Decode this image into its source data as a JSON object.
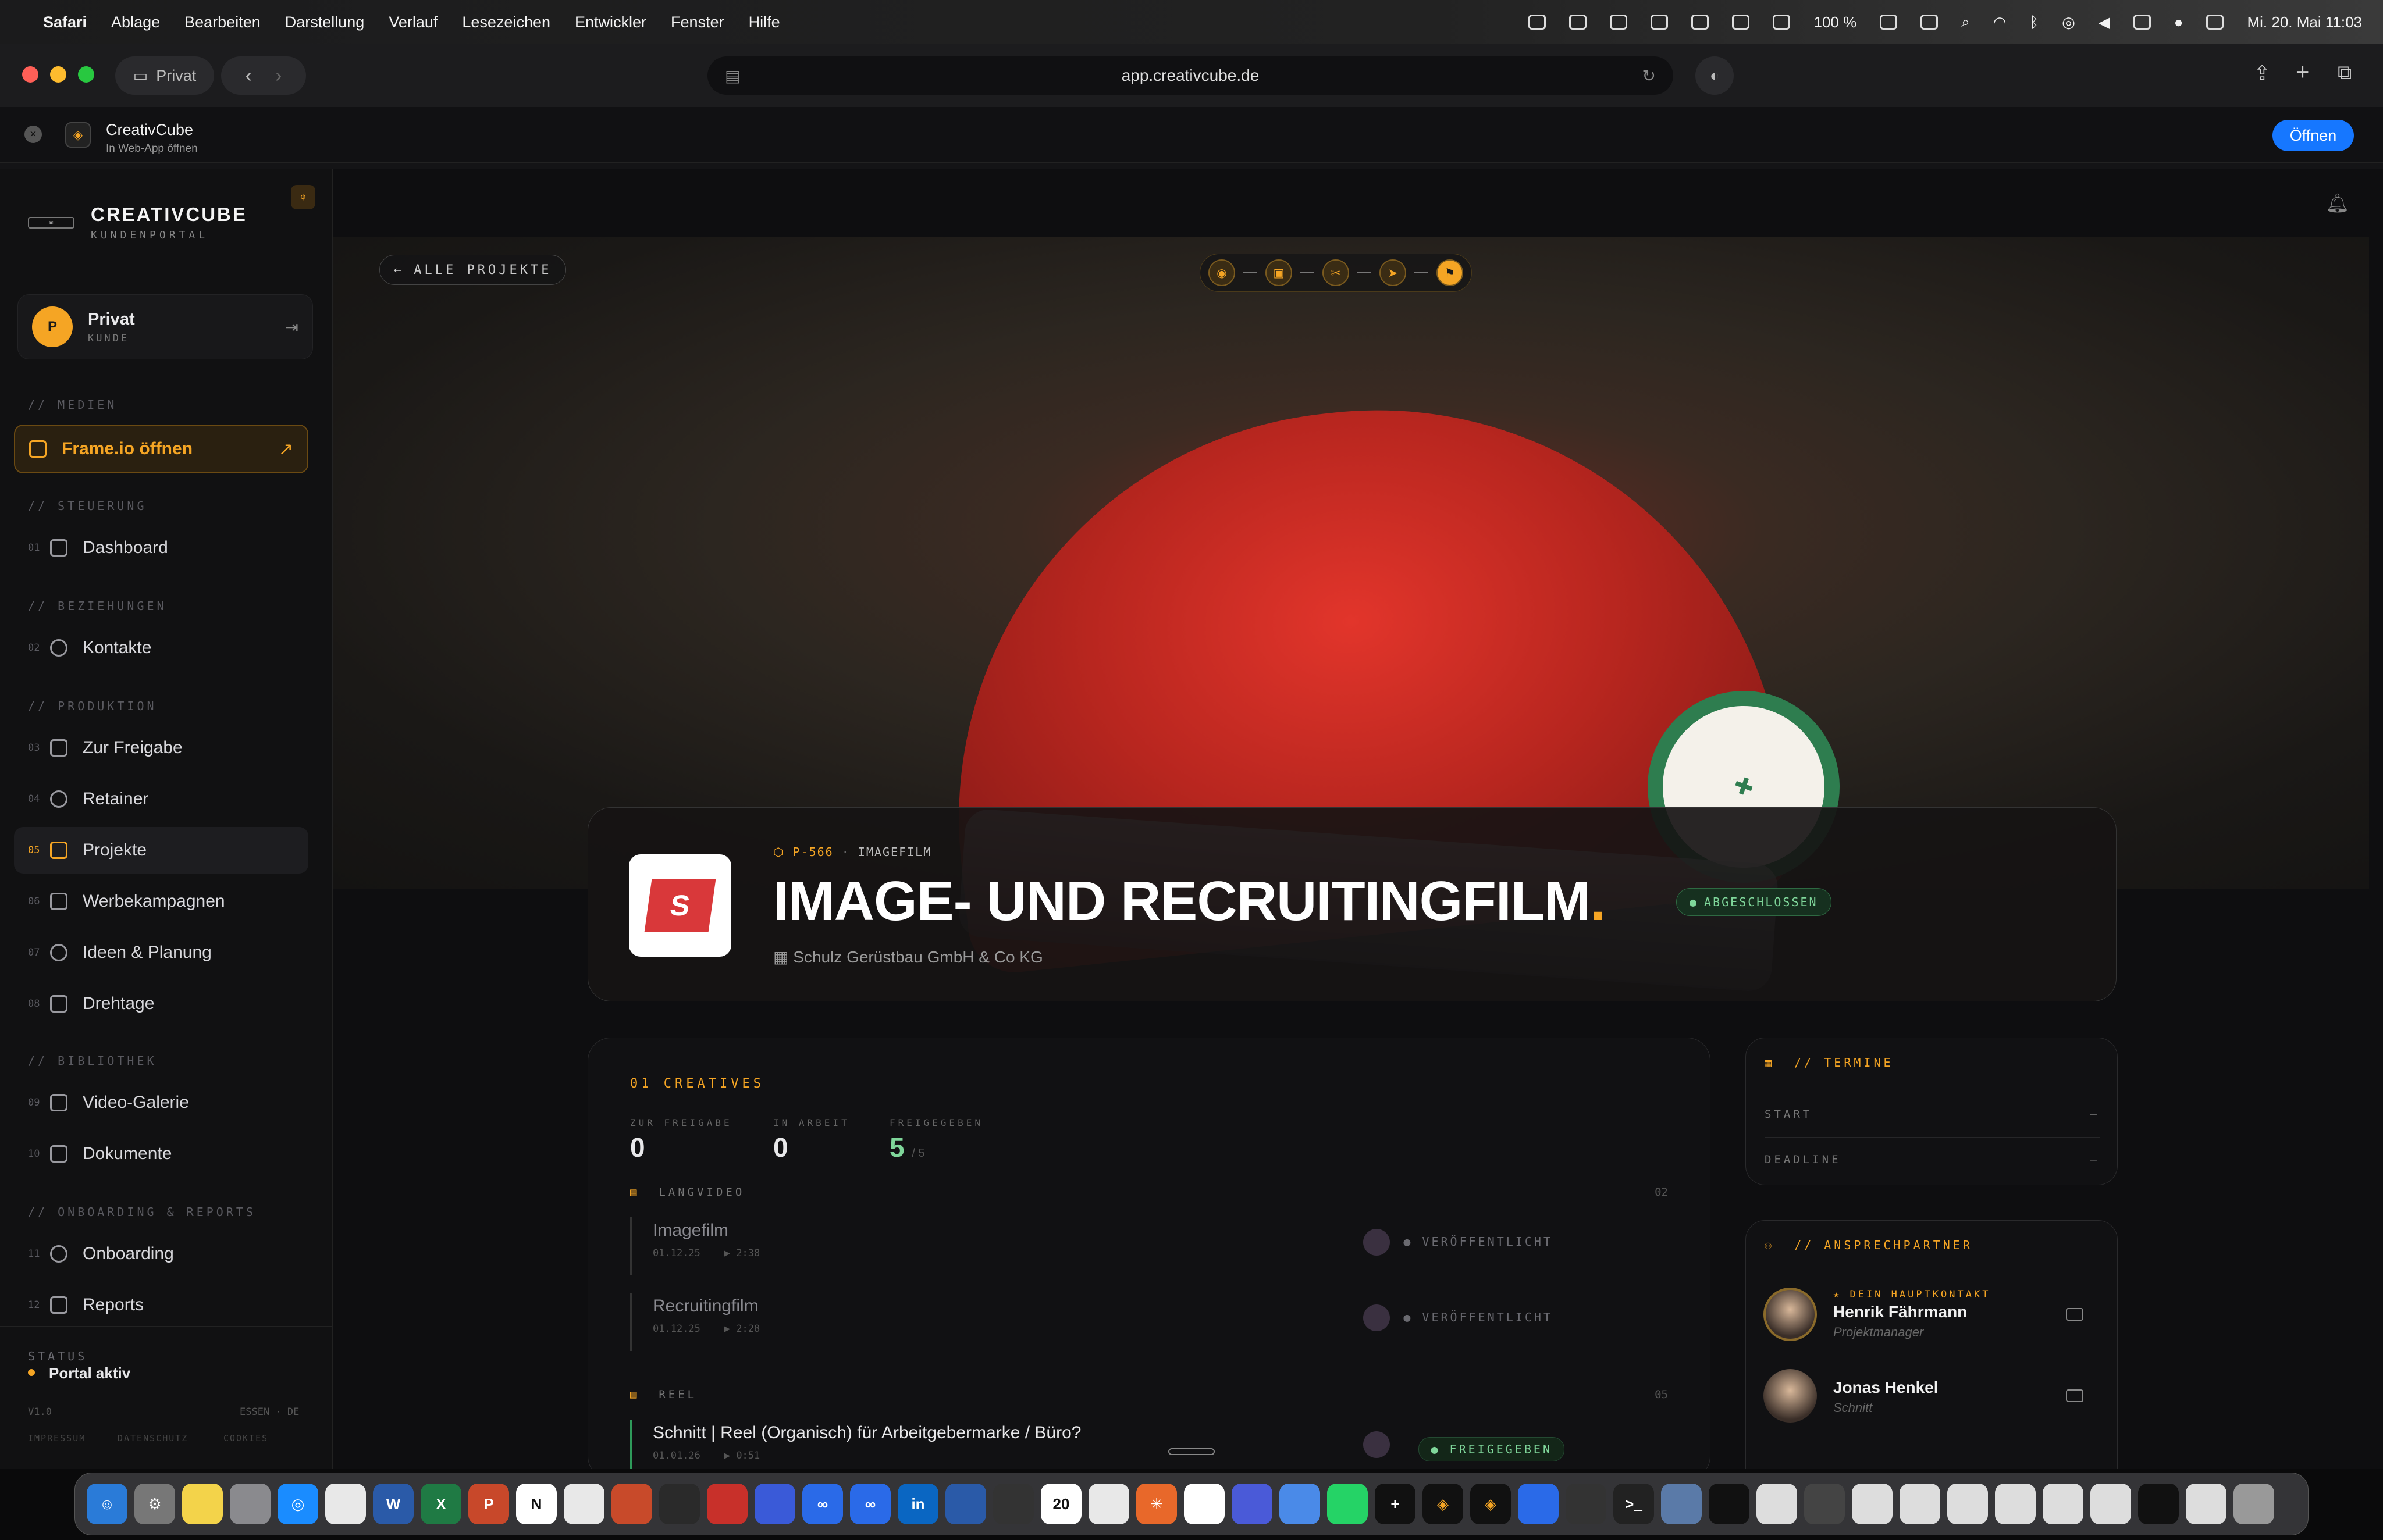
{
  "menubar": {
    "app": "Safari",
    "items": [
      "Ablage",
      "Bearbeiten",
      "Darstellung",
      "Verlauf",
      "Lesezeichen",
      "Entwickler",
      "Fenster",
      "Hilfe"
    ],
    "battery": "100 %",
    "datetime": "Mi. 20. Mai  11:03"
  },
  "browser": {
    "profile_label": "Privat",
    "url": "app.creativcube.de",
    "webapp_name": "CreativCube",
    "webapp_hint": "In Web-App öffnen",
    "open_label": "Öffnen"
  },
  "sidebar": {
    "brand_title": "CREATIVCUBE",
    "brand_sub": "KUNDENPORTAL",
    "user_initial": "P",
    "user_name": "Privat",
    "user_role": "KUNDE",
    "sec_media": "// MEDIEN",
    "frameio": "Frame.io öffnen",
    "sec_steuerung": "// STEUERUNG",
    "sec_beziehungen": "// BEZIEHUNGEN",
    "sec_produktion": "// PRODUKTION",
    "sec_bibliothek": "// BIBLIOTHEK",
    "sec_onboarding": "// ONBOARDING & REPORTS",
    "items": [
      {
        "num": "01",
        "label": "Dashboard"
      },
      {
        "num": "02",
        "label": "Kontakte"
      },
      {
        "num": "03",
        "label": "Zur Freigabe"
      },
      {
        "num": "04",
        "label": "Retainer"
      },
      {
        "num": "05",
        "label": "Projekte"
      },
      {
        "num": "06",
        "label": "Werbekampagnen"
      },
      {
        "num": "07",
        "label": "Ideen & Planung"
      },
      {
        "num": "08",
        "label": "Drehtage"
      },
      {
        "num": "09",
        "label": "Video-Galerie"
      },
      {
        "num": "10",
        "label": "Dokumente"
      },
      {
        "num": "11",
        "label": "Onboarding"
      },
      {
        "num": "12",
        "label": "Reports"
      }
    ],
    "status_label": "STATUS",
    "status_value": "Portal aktiv",
    "version": "V1.0",
    "location": "ESSEN · DE",
    "footer_links": [
      "IMPRESSUM",
      "DATENSCHUTZ",
      "COOKIES"
    ]
  },
  "project": {
    "back_label": "ALLE PROJEKTE",
    "code": "P-566",
    "type": "IMAGEFILM",
    "title": "IMAGE- UND RECRUITINGFILM",
    "title_dot": ".",
    "status": "ABGESCHLOSSEN",
    "client": "Schulz Gerüstbau GmbH & Co KG",
    "client_logo_letter": "S"
  },
  "creatives": {
    "heading": "01  CREATIVES",
    "stats": [
      {
        "label": "ZUR FREIGABE",
        "value": "0"
      },
      {
        "label": "IN ARBEIT",
        "value": "0"
      },
      {
        "label": "FREIGEGEBEN",
        "value": "5",
        "total": "/ 5"
      }
    ],
    "group1": {
      "name": "LANGVIDEO",
      "count": "02"
    },
    "group2": {
      "name": "REEL",
      "count": "05"
    },
    "rows": [
      {
        "title": "Imagefilm",
        "date": "01.12.25",
        "dur": "▶ 2:38",
        "tag": "● VERÖFFENTLICHT"
      },
      {
        "title": "Recruitingfilm",
        "date": "01.12.25",
        "dur": "▶ 2:28",
        "tag": "● VERÖFFENTLICHT"
      },
      {
        "title": "Schnitt | Reel (Organisch) für Arbeitgebermarke / Büro?",
        "date": "01.01.26",
        "dur": "▶ 0:51",
        "tag": "● FREIGEGEBEN"
      }
    ]
  },
  "termine": {
    "heading": "// TERMINE",
    "start_label": "START",
    "start_value": "—",
    "deadline_label": "DEADLINE",
    "deadline_value": "—"
  },
  "ansprechpartner": {
    "heading": "// ANSPRECHPARTNER",
    "main_tag": "★ DEIN HAUPTKONTAKT",
    "contacts": [
      {
        "name": "Henrik Fährmann",
        "role": "Projektmanager"
      },
      {
        "name": "Jonas Henkel",
        "role": "Schnitt"
      }
    ]
  },
  "colors": {
    "accent": "#f5a524",
    "success": "#7fd69a",
    "open_button": "#1677ff"
  }
}
